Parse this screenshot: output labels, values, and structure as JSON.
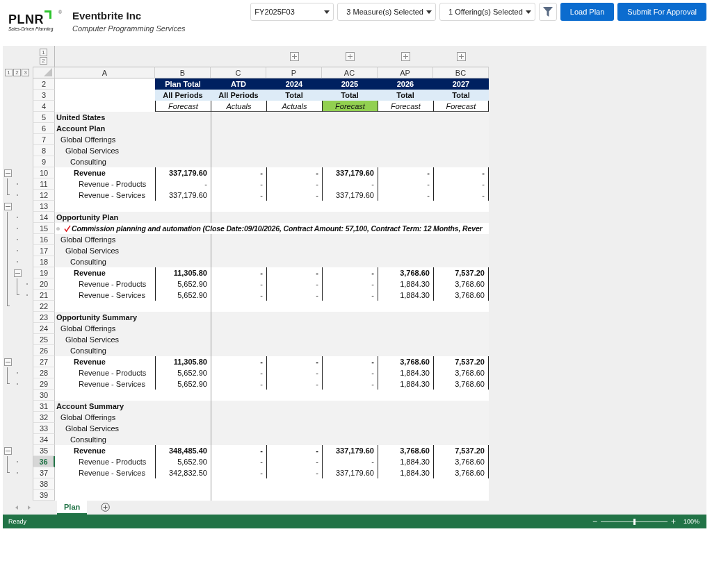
{
  "header": {
    "logo": {
      "wordmark": "PLNR",
      "registered": "®",
      "tagline": "Sales-Driven Planning"
    },
    "company": "Eventbrite Inc",
    "industry": "Computer Programming Services"
  },
  "toolbar": {
    "period": {
      "value": "FY2025F03"
    },
    "measures": "3 Measure(s) Selected",
    "offerings": "1 Offering(s) Selected",
    "buttons": [
      "Load Plan",
      "Submit For Approval"
    ]
  },
  "sheet": {
    "column_levels": [
      "1",
      "2"
    ],
    "row_levels": [
      "1",
      "2",
      "3"
    ],
    "columns": [
      {
        "letter": "A",
        "group_button": false
      },
      {
        "letter": "B",
        "group_button": false
      },
      {
        "letter": "C",
        "group_button": false
      },
      {
        "letter": "P",
        "group_button": true
      },
      {
        "letter": "AC",
        "group_button": true
      },
      {
        "letter": "AP",
        "group_button": true
      },
      {
        "letter": "BC",
        "group_button": true
      }
    ],
    "rows": [
      {
        "number": "2",
        "kind": "header_year",
        "selected": false,
        "cells": [
          "Plan Total",
          "ATD",
          "2024",
          "2025",
          "2026",
          "2027"
        ]
      },
      {
        "number": "3",
        "kind": "header_period",
        "selected": false,
        "cells": [
          "All Periods",
          "All Periods",
          "Total",
          "Total",
          "Total",
          "Total"
        ]
      },
      {
        "number": "4",
        "kind": "header_type",
        "selected": false,
        "cells": [
          {
            "text": "Forecast",
            "highlighted": false
          },
          {
            "text": "Actuals",
            "highlighted": false
          },
          {
            "text": "Actuals",
            "highlighted": false
          },
          {
            "text": "Forecast",
            "highlighted": true
          },
          {
            "text": "Forecast",
            "highlighted": false
          },
          {
            "text": "Forecast",
            "highlighted": false
          }
        ]
      },
      {
        "number": "5",
        "kind": "section",
        "selected": false,
        "label": "United States"
      },
      {
        "number": "6",
        "kind": "section",
        "selected": false,
        "label": "Account Plan"
      },
      {
        "number": "7",
        "kind": "level1",
        "selected": false,
        "label": "Global Offerings"
      },
      {
        "number": "8",
        "kind": "level2",
        "selected": false,
        "label": "Global Services"
      },
      {
        "number": "9",
        "kind": "level3",
        "selected": false,
        "label": "Consulting"
      },
      {
        "number": "10",
        "kind": "total",
        "selected": false,
        "outline": [
          {
            "kind": "toggle"
          }
        ],
        "label": "Revenue",
        "values": [
          "337,179.60",
          "-",
          "-",
          "337,179.60",
          "-",
          "-"
        ]
      },
      {
        "number": "11",
        "kind": "line",
        "selected": false,
        "outline": [
          {
            "kind": "line"
          },
          {
            "kind": "dot"
          }
        ],
        "label": "Revenue - Products",
        "values": [
          "-",
          "-",
          "-",
          "-",
          "-",
          "-"
        ]
      },
      {
        "number": "12",
        "kind": "line",
        "selected": false,
        "outline": [
          {
            "kind": "end"
          },
          {
            "kind": "dot"
          }
        ],
        "label": "Revenue - Services",
        "values": [
          "337,179.60",
          "-",
          "-",
          "337,179.60",
          "-",
          "-"
        ]
      },
      {
        "number": "13",
        "kind": "blank",
        "selected": false,
        "outline": [
          {
            "kind": "toggle"
          }
        ]
      },
      {
        "number": "14",
        "kind": "section",
        "selected": false,
        "outline": [
          {
            "kind": "line"
          },
          {
            "kind": "dot"
          }
        ],
        "label": "Opportunity Plan"
      },
      {
        "number": "15",
        "kind": "opportunity",
        "selected": false,
        "outline": [
          {
            "kind": "line"
          },
          {
            "kind": "dot"
          }
        ],
        "label": "Commission planning and automation (Close Date:09/10/2026, Contract Amount:  57,100, Contract Term: 12 Months, Rever"
      },
      {
        "number": "16",
        "kind": "level1",
        "selected": false,
        "outline": [
          {
            "kind": "line"
          },
          {
            "kind": "dot"
          }
        ],
        "label": "Global Offerings"
      },
      {
        "number": "17",
        "kind": "level2",
        "selected": false,
        "outline": [
          {
            "kind": "line"
          },
          {
            "kind": "dot"
          }
        ],
        "label": "Global Services"
      },
      {
        "number": "18",
        "kind": "level3",
        "selected": false,
        "outline": [
          {
            "kind": "line"
          },
          {
            "kind": "dot"
          }
        ],
        "label": "Consulting"
      },
      {
        "number": "19",
        "kind": "total",
        "selected": false,
        "outline": [
          {
            "kind": "line"
          },
          {
            "kind": "toggle"
          }
        ],
        "label": "Revenue",
        "values": [
          "11,305.80",
          "-",
          "-",
          "-",
          "3,768.60",
          "7,537.20"
        ]
      },
      {
        "number": "20",
        "kind": "line",
        "selected": false,
        "outline": [
          {
            "kind": "line"
          },
          {
            "kind": "line"
          },
          {
            "kind": "dot"
          }
        ],
        "label": "Revenue - Products",
        "values": [
          "5,652.90",
          "-",
          "-",
          "-",
          "1,884.30",
          "3,768.60"
        ]
      },
      {
        "number": "21",
        "kind": "line",
        "selected": false,
        "outline": [
          {
            "kind": "line"
          },
          {
            "kind": "end"
          },
          {
            "kind": "dot"
          }
        ],
        "label": "Revenue - Services",
        "values": [
          "5,652.90",
          "-",
          "-",
          "-",
          "1,884.30",
          "3,768.60"
        ]
      },
      {
        "number": "22",
        "kind": "blank",
        "selected": false,
        "outline": [
          {
            "kind": "end"
          }
        ]
      },
      {
        "number": "23",
        "kind": "section",
        "selected": false,
        "label": "Opportunity Summary"
      },
      {
        "number": "24",
        "kind": "level1",
        "selected": false,
        "label": "Global Offerings"
      },
      {
        "number": "25",
        "kind": "level2",
        "selected": false,
        "label": "Global Services"
      },
      {
        "number": "26",
        "kind": "level3",
        "selected": false,
        "label": "Consulting"
      },
      {
        "number": "27",
        "kind": "total",
        "selected": false,
        "outline": [
          {
            "kind": "toggle"
          }
        ],
        "label": "Revenue",
        "values": [
          "11,305.80",
          "-",
          "-",
          "-",
          "3,768.60",
          "7,537.20"
        ]
      },
      {
        "number": "28",
        "kind": "line",
        "selected": false,
        "outline": [
          {
            "kind": "line"
          },
          {
            "kind": "dot"
          }
        ],
        "label": "Revenue - Products",
        "values": [
          "5,652.90",
          "-",
          "-",
          "-",
          "1,884.30",
          "3,768.60"
        ]
      },
      {
        "number": "29",
        "kind": "line",
        "selected": false,
        "outline": [
          {
            "kind": "end"
          },
          {
            "kind": "dot"
          }
        ],
        "label": "Revenue - Services",
        "values": [
          "5,652.90",
          "-",
          "-",
          "-",
          "1,884.30",
          "3,768.60"
        ]
      },
      {
        "number": "30",
        "kind": "blank",
        "selected": false
      },
      {
        "number": "31",
        "kind": "section",
        "selected": false,
        "label": "Account Summary"
      },
      {
        "number": "32",
        "kind": "level1",
        "selected": false,
        "label": "Global Offerings"
      },
      {
        "number": "33",
        "kind": "level2",
        "selected": false,
        "label": "Global Services"
      },
      {
        "number": "34",
        "kind": "level3",
        "selected": false,
        "label": "Consulting"
      },
      {
        "number": "35",
        "kind": "total",
        "selected": false,
        "outline": [
          {
            "kind": "toggle"
          }
        ],
        "label": "Revenue",
        "values": [
          "348,485.40",
          "-",
          "-",
          "337,179.60",
          "3,768.60",
          "7,537.20"
        ]
      },
      {
        "number": "36",
        "kind": "line",
        "selected": true,
        "outline": [
          {
            "kind": "line"
          },
          {
            "kind": "dot"
          }
        ],
        "label": "Revenue - Products",
        "values": [
          "5,652.90",
          "-",
          "-",
          "-",
          "1,884.30",
          "3,768.60"
        ]
      },
      {
        "number": "37",
        "kind": "line",
        "selected": false,
        "outline": [
          {
            "kind": "end"
          },
          {
            "kind": "dot"
          }
        ],
        "label": "Revenue - Services",
        "values": [
          "342,832.50",
          "-",
          "-",
          "337,179.60",
          "1,884.30",
          "3,768.60"
        ]
      },
      {
        "number": "38",
        "kind": "blank",
        "selected": false
      },
      {
        "number": "39",
        "kind": "blank",
        "selected": false
      }
    ]
  },
  "sheet_tabs": [
    {
      "label": "Plan",
      "selected": true
    }
  ],
  "status_bar": {
    "status": "Ready",
    "zoom_out": "−",
    "zoom": {
      "level": 0.5
    },
    "zoom_in": "+",
    "zoom_reading": "100%"
  }
}
